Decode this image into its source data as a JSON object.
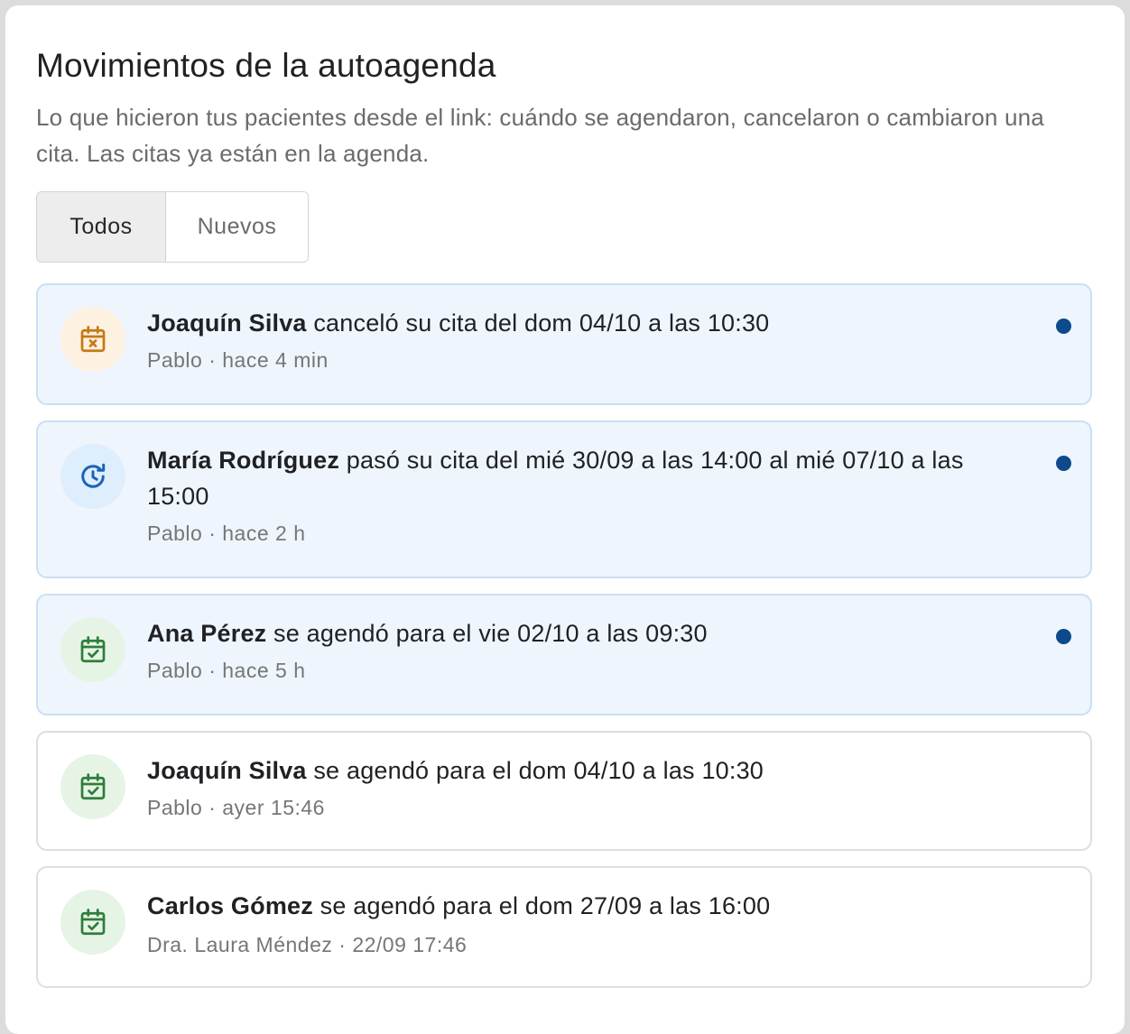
{
  "header": {
    "title": "Movimientos de la autoagenda",
    "subtitle": "Lo que hicieron tus pacientes desde el link: cuándo se agendaron, cancelaron o cambiaron una cita. Las citas ya están en la agenda."
  },
  "tabs": [
    {
      "label": "Todos",
      "active": true
    },
    {
      "label": "Nuevos",
      "active": false
    }
  ],
  "items": [
    {
      "type": "cancel",
      "icon": "calendar-x-icon",
      "patient": "Joaquín Silva",
      "action": " canceló su cita del dom 04/10 a las 10:30",
      "meta": "Pablo · hace 4 min",
      "unread": true
    },
    {
      "type": "move",
      "icon": "clock-rotate-icon",
      "patient": "María Rodríguez",
      "action": " pasó su cita del mié 30/09 a las 14:00 al mié 07/10 a las 15:00",
      "meta": "Pablo · hace 2 h",
      "unread": true
    },
    {
      "type": "booked",
      "icon": "calendar-check-icon",
      "patient": "Ana Pérez",
      "action": " se agendó para el vie 02/10 a las 09:30",
      "meta": "Pablo · hace 5 h",
      "unread": true
    },
    {
      "type": "booked",
      "icon": "calendar-check-icon",
      "patient": "Joaquín Silva",
      "action": " se agendó para el dom 04/10 a las 10:30",
      "meta": "Pablo · ayer 15:46",
      "unread": false
    },
    {
      "type": "booked",
      "icon": "calendar-check-icon",
      "patient": "Carlos Gómez",
      "action": " se agendó para el dom 27/09 a las 16:00",
      "meta": "Dra. Laura Méndez · 22/09 17:46",
      "unread": false
    }
  ],
  "colors": {
    "unread_dot": "#0d4a8c",
    "cancel_icon": "#c67a12",
    "move_icon": "#1a63b8",
    "booked_icon": "#2f7d3a",
    "unread_bg": "#eff5fd"
  }
}
